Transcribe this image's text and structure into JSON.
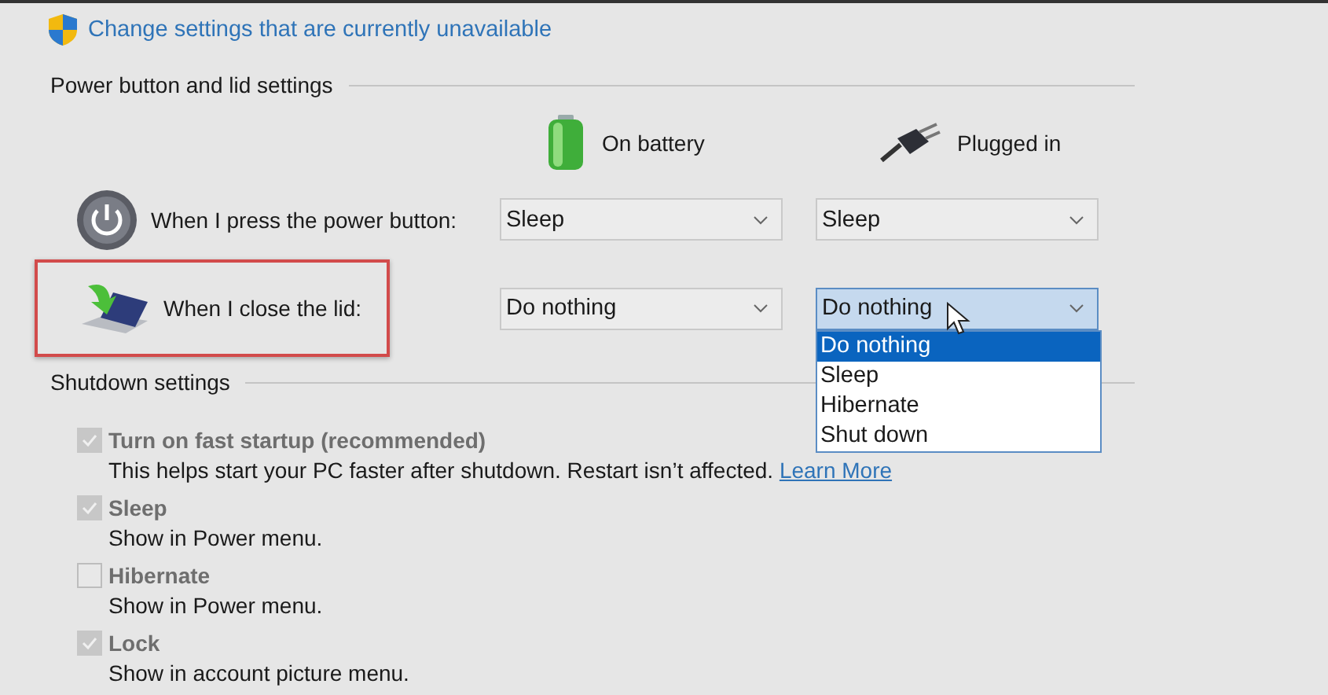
{
  "link": {
    "text": "Change settings that are currently unavailable"
  },
  "power_section": {
    "title": "Power button and lid settings",
    "columns": [
      {
        "kind": "battery",
        "label": "On battery"
      },
      {
        "kind": "plug",
        "label": "Plugged in"
      }
    ],
    "rows": [
      {
        "kind": "power",
        "label": "When I press the power button:",
        "highlighted": false,
        "values": [
          {
            "value": "Sleep",
            "open": false
          },
          {
            "value": "Sleep",
            "open": false
          }
        ]
      },
      {
        "kind": "lid",
        "label": "When I close the lid:",
        "highlighted": true,
        "values": [
          {
            "value": "Do nothing",
            "open": false
          },
          {
            "value": "Do nothing",
            "open": true,
            "options": [
              {
                "label": "Do nothing",
                "selected": true
              },
              {
                "label": "Sleep",
                "selected": false
              },
              {
                "label": "Hibernate",
                "selected": false
              },
              {
                "label": "Shut down",
                "selected": false
              }
            ]
          }
        ]
      }
    ]
  },
  "shutdown_section": {
    "title": "Shutdown settings",
    "items": [
      {
        "label": "Turn on fast startup (recommended)",
        "checked": true,
        "disabled": true,
        "description": "This helps start your PC faster after shutdown. Restart isn’t affected.",
        "link": "Learn More"
      },
      {
        "label": "Sleep",
        "checked": true,
        "disabled": true,
        "description": "Show in Power menu."
      },
      {
        "label": "Hibernate",
        "checked": false,
        "disabled": true,
        "description": "Show in Power menu."
      },
      {
        "label": "Lock",
        "checked": true,
        "disabled": true,
        "description": "Show in account picture menu."
      }
    ]
  }
}
